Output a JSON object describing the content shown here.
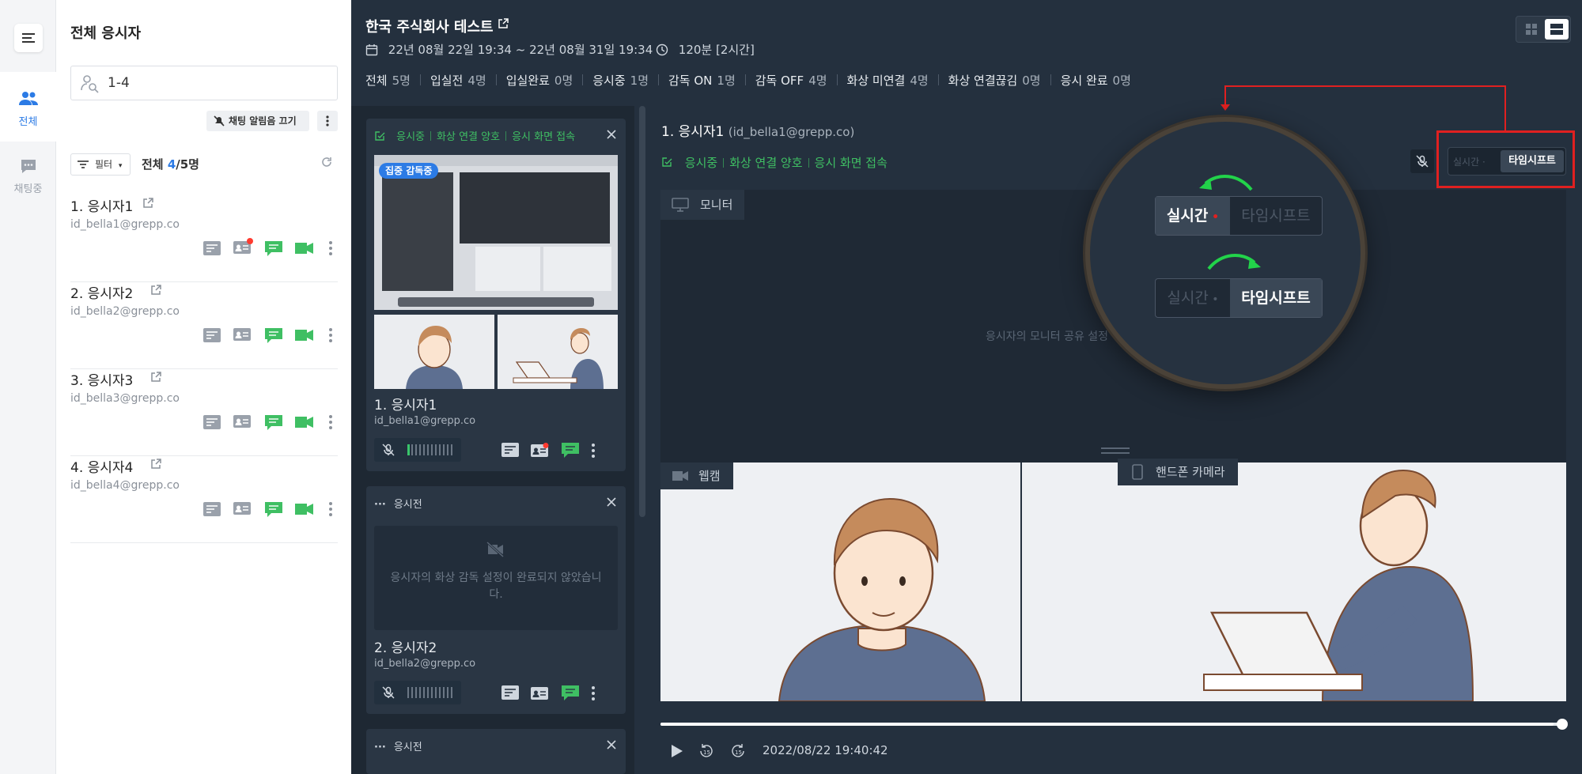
{
  "rail": {
    "tabs": [
      {
        "label": "전체",
        "icon": "people-icon",
        "active": true
      },
      {
        "label": "채팅중",
        "icon": "chat-icon",
        "active": false
      }
    ]
  },
  "list": {
    "title": "전체 응시자",
    "search_value": "1-4",
    "mute_chat_label": "채팅 알림음 끄기",
    "filter_label": "필터",
    "count_prefix": "전체 ",
    "count_current": "4",
    "count_total": "/5명",
    "participants": [
      {
        "name": "1. 응시자1",
        "email": "id_bella1@grepp.co",
        "has_alert": true
      },
      {
        "name": "2. 응시자2",
        "email": "id_bella2@grepp.co",
        "has_alert": false
      },
      {
        "name": "3. 응시자3",
        "email": "id_bella3@grepp.co",
        "has_alert": false
      },
      {
        "name": "4. 응시자4",
        "email": "id_bella4@grepp.co",
        "has_alert": false
      }
    ]
  },
  "exam": {
    "title": "한국 주식회사 테스트",
    "date_range": "22년 08월 22일 19:34 ~ 22년 08월 31일 19:34",
    "duration": "120분 [2시간]",
    "stats": [
      {
        "label": "전체",
        "value": "5명"
      },
      {
        "label": "입실전",
        "value": "4명"
      },
      {
        "label": "입실완료",
        "value": "0명"
      },
      {
        "label": "응시중",
        "value": "1명"
      },
      {
        "label": "감독 ON",
        "value": "1명"
      },
      {
        "label": "감독 OFF",
        "value": "4명"
      },
      {
        "label": "화상 미연결",
        "value": "4명"
      },
      {
        "label": "화상 연결끊김",
        "value": "0명"
      },
      {
        "label": "응시 완료",
        "value": "0명"
      }
    ]
  },
  "cards": [
    {
      "status_items": [
        "응시중",
        "화상 연결 양호",
        "응시 화면 접속"
      ],
      "focus_badge": "집중 감독중",
      "name": "1. 응시자1",
      "email": "id_bella1@grepp.co"
    },
    {
      "status": "응시전",
      "placeholder": "응시자의 화상 감독 설정이 완료되지 않았습니다.",
      "name": "2. 응시자2",
      "email": "id_bella2@grepp.co"
    },
    {
      "status": "응시전"
    }
  ],
  "detail": {
    "name": "1. 응시자1",
    "email": "(id_bella1@grepp.co)",
    "status_items": [
      "응시중",
      "화상 연결 양호",
      "응시 화면 접속"
    ],
    "mode_realtime": "실시간",
    "mode_timeshift": "타임시프트",
    "monitor_label": "모니터",
    "monitor_message": "응시자의 모니터 공유 설정",
    "webcam_label": "웹캠",
    "phone_label": "핸드폰 카메라",
    "timestamp": "2022/08/22 19:40:42",
    "playback_progress": 0.99
  },
  "colors": {
    "accent_blue": "#2c7be5",
    "status_green": "#3fbf63",
    "highlight_red": "#e02020",
    "dark_bg": "#24303e"
  }
}
